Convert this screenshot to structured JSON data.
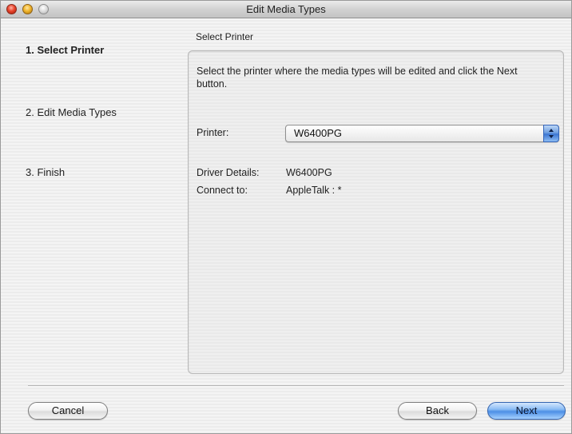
{
  "window": {
    "title": "Edit Media Types"
  },
  "steps": [
    {
      "label": "1. Select Printer"
    },
    {
      "label": "2. Edit Media Types"
    },
    {
      "label": "3. Finish"
    }
  ],
  "section": {
    "heading": "Select Printer"
  },
  "panel": {
    "instructions": "Select the printer where the media types will be edited and click the Next button.",
    "printer_label": "Printer:",
    "printer_value": "W6400PG",
    "driver_label": "Driver Details:",
    "driver_value": "W6400PG",
    "connect_label": "Connect to:",
    "connect_value": "AppleTalk : *"
  },
  "buttons": {
    "cancel": "Cancel",
    "back": "Back",
    "next": "Next"
  },
  "colors": {
    "accent": "#4d8fe6"
  },
  "icons": {
    "select_arrows": "up-down-arrows-icon"
  }
}
